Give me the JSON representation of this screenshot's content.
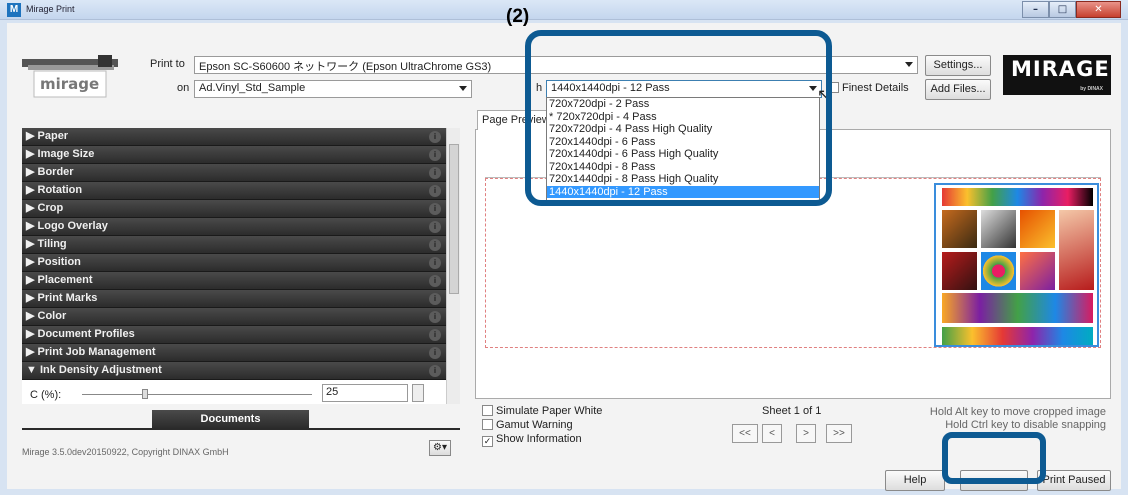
{
  "window": {
    "title": "Mirage Print",
    "app_icon": "M"
  },
  "header": {
    "print_to_label": "Print to",
    "printer_value": "Epson SC-S60600 ネットワーク (Epson UltraChrome GS3)",
    "on_label": "on",
    "media_value": "Ad.Vinyl_Std_Sample",
    "with_label_fragment": "h",
    "quality_value": "1440x1440dpi - 12 Pass",
    "finest_details_label": "Finest Details",
    "settings_button": "Settings...",
    "add_files_button": "Add Files...",
    "brand": "MIRAGE",
    "brand_sub": "by DINAX",
    "printer_logo_text": "mirage"
  },
  "dropdown": {
    "options": [
      "720x720dpi - 2 Pass",
      "* 720x720dpi - 4 Pass",
      "720x720dpi - 4 Pass High Quality",
      "720x1440dpi - 6 Pass",
      "720x1440dpi - 6 Pass High Quality",
      "720x1440dpi - 8 Pass",
      "720x1440dpi - 8 Pass High Quality",
      "1440x1440dpi - 12 Pass"
    ],
    "selected_index": 7
  },
  "sidebar": {
    "items": [
      "▶ Paper",
      "▶ Image Size",
      "▶ Border",
      "▶ Rotation",
      "▶ Crop",
      "▶ Logo Overlay",
      "▶ Tiling",
      "▶ Position",
      "▶ Placement",
      "▶ Print Marks",
      "▶ Color",
      "▶ Document Profiles",
      "▶ Print Job Management",
      "▼ Ink Density Adjustment"
    ],
    "help_glyph": "i",
    "ink_label": "C (%):",
    "ink_value": "25",
    "documents_tab": "Documents",
    "version": "Mirage 3.5.0dev20150922, Copyright DINAX GmbH",
    "gear_glyph": "⚙▾"
  },
  "preview": {
    "tab_label": "Page Preview",
    "simulate_paper_white": "Simulate Paper White",
    "gamut_warning": "Gamut Warning",
    "show_information": "Show Information",
    "show_information_checked": true,
    "sheet_label": "Sheet 1 of 1",
    "nav": [
      "<<",
      "<",
      ">",
      ">>"
    ],
    "hint_alt": "Hold Alt key to move cropped image",
    "hint_ctrl": "Hold Ctrl key to disable snapping"
  },
  "footer": {
    "help_button": "Help",
    "print_paused_button": "Print Paused"
  },
  "annotation": {
    "step_label": "(2)",
    "highlight_color": "#0d5a92"
  },
  "colors": {
    "accordion": "#2c2c2c",
    "selection": "#3399ff",
    "image_border": "#3a8ddc"
  }
}
